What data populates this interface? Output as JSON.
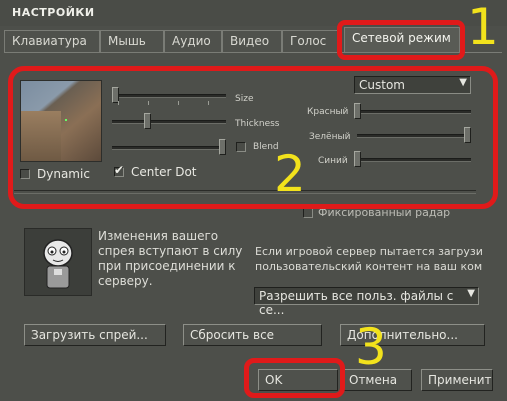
{
  "window": {
    "title": "НАСТРОЙКИ"
  },
  "tabs": [
    {
      "label": "Клавиатура"
    },
    {
      "label": "Мышь"
    },
    {
      "label": "Аудио"
    },
    {
      "label": "Видео"
    },
    {
      "label": "Голос"
    },
    {
      "label": "Сетевой режим",
      "active": true
    }
  ],
  "crosshair": {
    "preset": "Custom",
    "size_label": "Size",
    "thickness_label": "Thickness",
    "blend_label": "Blend",
    "red_label": "Красный",
    "green_label": "Зелёный",
    "blue_label": "Синий",
    "dynamic_label": "Dynamic",
    "center_dot_label": "Center Dot",
    "center_dot_checked": true,
    "dynamic_checked": false,
    "blend_checked": false,
    "size_value": 0.0,
    "thickness_value": 0.33,
    "blend_value": 1.0,
    "red_value": 0.0,
    "green_value": 1.0,
    "blue_value": 0.0
  },
  "spray": {
    "hidden_label": "Фиксированный радар",
    "info_text": "Изменения вашего спрея вступают в силу при присоединении к серверу.",
    "server_text": "Если игровой сервер пытается загрузи пользовательский контент на ваш ком",
    "download_option": "Разрешить все польз. файлы с се...",
    "load_spray_button": "Загрузить спрей...",
    "reset_all_button": "Сбросить все",
    "advanced_button": "Дополнительно..."
  },
  "footer": {
    "ok_button": "OK",
    "cancel_button": "Отмена",
    "apply_button": "Применить"
  },
  "annotations": [
    "1",
    "2",
    "3"
  ],
  "colors": {
    "annotation_red": "#e01a1a",
    "annotation_yellow": "#f2e21c",
    "panel": "#4d4f4a"
  }
}
